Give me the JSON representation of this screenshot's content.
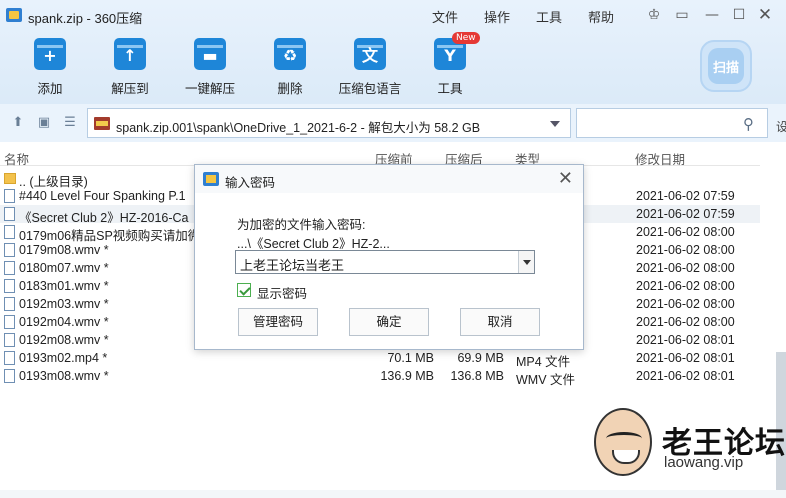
{
  "window": {
    "title": "spank.zip - 360压缩",
    "menus": [
      "文件",
      "操作",
      "工具",
      "帮助"
    ]
  },
  "toolbar": {
    "items": [
      {
        "label": "添加",
        "icon": "add-icon",
        "glyph": "+"
      },
      {
        "label": "解压到",
        "icon": "extract-icon",
        "glyph": "↑"
      },
      {
        "label": "一键解压",
        "icon": "one-click-extract-icon",
        "glyph": "▬"
      },
      {
        "label": "删除",
        "icon": "recycle-bin-icon",
        "glyph": "♻"
      },
      {
        "label": "压缩包语言",
        "icon": "language-icon",
        "glyph": "文"
      },
      {
        "label": "工具",
        "icon": "tools-icon",
        "glyph": "Y"
      }
    ],
    "new_badge": "New",
    "scan_label": "扫描"
  },
  "address": {
    "path": "spank.zip.001\\spank\\OneDrive_1_2021-6-2 - 解包大小为 58.2 GB",
    "search_placeholder": "",
    "side_char": "设"
  },
  "columns": {
    "name": "名称",
    "compressed": "压缩前",
    "size": "压缩后",
    "type": "类型",
    "modified": "修改日期"
  },
  "files": [
    {
      "name": ".. (上级目录)",
      "before": "",
      "after": "",
      "type": "",
      "date": "",
      "folder": true
    },
    {
      "name": "#440 Level Four Spanking P.1",
      "before": "",
      "after": "",
      "type": "",
      "date": "2021-06-02 07:59"
    },
    {
      "name": "《Secret Club 2》HZ-2016-Ca",
      "before": "",
      "after": "",
      "type": "",
      "date": "2021-06-02 07:59",
      "selected": true
    },
    {
      "name": "0179m06精品SP视频购买请加微",
      "before": "",
      "after": "",
      "type": "",
      "date": "2021-06-02 08:00"
    },
    {
      "name": "0179m08.wmv *",
      "before": "",
      "after": "",
      "type": "",
      "date": "2021-06-02 08:00"
    },
    {
      "name": "0180m07.wmv *",
      "before": "",
      "after": "",
      "type": "",
      "date": "2021-06-02 08:00"
    },
    {
      "name": "0183m01.wmv *",
      "before": "",
      "after": "",
      "type": "",
      "date": "2021-06-02 08:00"
    },
    {
      "name": "0192m03.wmv *",
      "before": "",
      "after": "",
      "type": "",
      "date": "2021-06-02 08:00"
    },
    {
      "name": "0192m04.wmv *",
      "before": "",
      "after": "",
      "type": "",
      "date": "2021-06-02 08:00"
    },
    {
      "name": "0192m08.wmv *",
      "before": "",
      "after": "",
      "type": "",
      "date": "2021-06-02 08:01"
    },
    {
      "name": "0193m02.mp4 *",
      "before": "70.1 MB",
      "after": "69.9 MB",
      "type": "MP4 文件",
      "date": "2021-06-02 08:01"
    },
    {
      "name": "0193m08.wmv *",
      "before": "136.9 MB",
      "after": "136.8 MB",
      "type": "WMV 文件",
      "date": "2021-06-02 08:01"
    }
  ],
  "dialog": {
    "title": "输入密码",
    "prompt": "为加密的文件输入密码:",
    "path": "...\\《Secret Club 2》HZ-2...",
    "password": "上老王论坛当老王",
    "show_password_label": "显示密码",
    "show_password_checked": true,
    "buttons": {
      "manage": "管理密码",
      "ok": "确定",
      "cancel": "取消"
    }
  },
  "watermark": {
    "title": "老王论坛",
    "url": "laowang.vip"
  },
  "colors": {
    "toolbar_icon": "#1e86d8",
    "titlebar_bg": "#e8f2fc",
    "checkbox": "#4caf50"
  }
}
